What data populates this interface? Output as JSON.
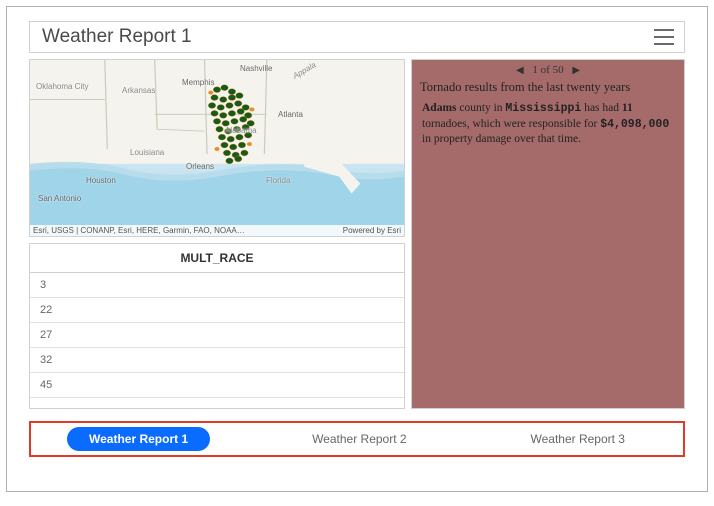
{
  "header": {
    "title": "Weather Report 1"
  },
  "map": {
    "attrib_left": "Esri, USGS | CONANP, Esri, HERE, Garmin, FAO, NOAA…",
    "attrib_right": "Powered by Esri",
    "labels": {
      "oklahoma_city": "Oklahoma City",
      "arkansas": "Arkansas",
      "memphis": "Memphis",
      "nashville": "Nashville",
      "alabama": "Alabama",
      "atlanta": "Atlanta",
      "louisiana": "Louisiana",
      "orleans": "Orleans",
      "houston": "Houston",
      "san_antonio": "San Antonio",
      "florida": "Florida",
      "appala": "Appala"
    }
  },
  "table": {
    "header": "MULT_RACE",
    "rows": [
      "3",
      "22",
      "27",
      "32",
      "45"
    ]
  },
  "detail": {
    "pager": {
      "pos": "1",
      "of": "of",
      "total": "50"
    },
    "title": "Tornado results from the last twenty years",
    "county": "Adams",
    "t1": " county in ",
    "state": "Mississippi",
    "t2": " has had ",
    "count": "11",
    "t3": " tornadoes, which were responsible for ",
    "damage": "$4,098,000",
    "t4": " in property damage over that time."
  },
  "tabs": {
    "t1": "Weather Report 1",
    "t2": "Weather Report 2",
    "t3": "Weather Report 3"
  }
}
